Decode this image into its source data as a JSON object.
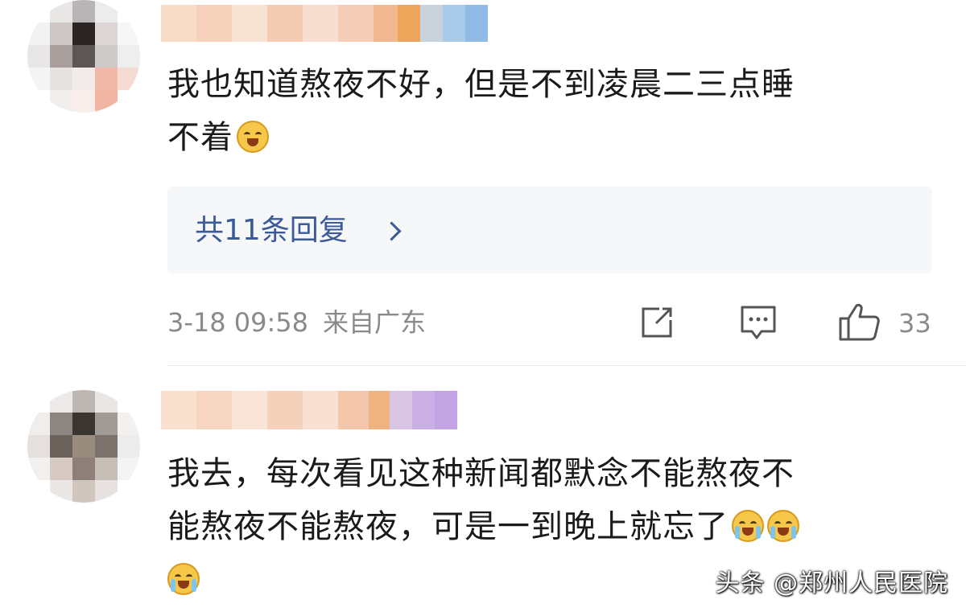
{
  "comments": [
    {
      "text_line1": "我也知道熬夜不好，但是不到凌晨二三点睡",
      "text_line2": "不着",
      "emoji": "laughing-emoji",
      "replies_label": "共11条回复",
      "timestamp": "3-18 09:58",
      "location": "来自广东",
      "like_count": "33"
    },
    {
      "text_line1": "我去，每次看见这种新闻都默念不能熬夜不",
      "text_line2": "能熬夜不能熬夜，可是一到晚上就忘了",
      "emoji": "crying-emoji"
    }
  ],
  "watermark": "头条 @郑州人民医院",
  "colors": {
    "link": "#3c5a96",
    "meta": "#8a8a8a",
    "reply_bg": "#f6f7f9"
  }
}
